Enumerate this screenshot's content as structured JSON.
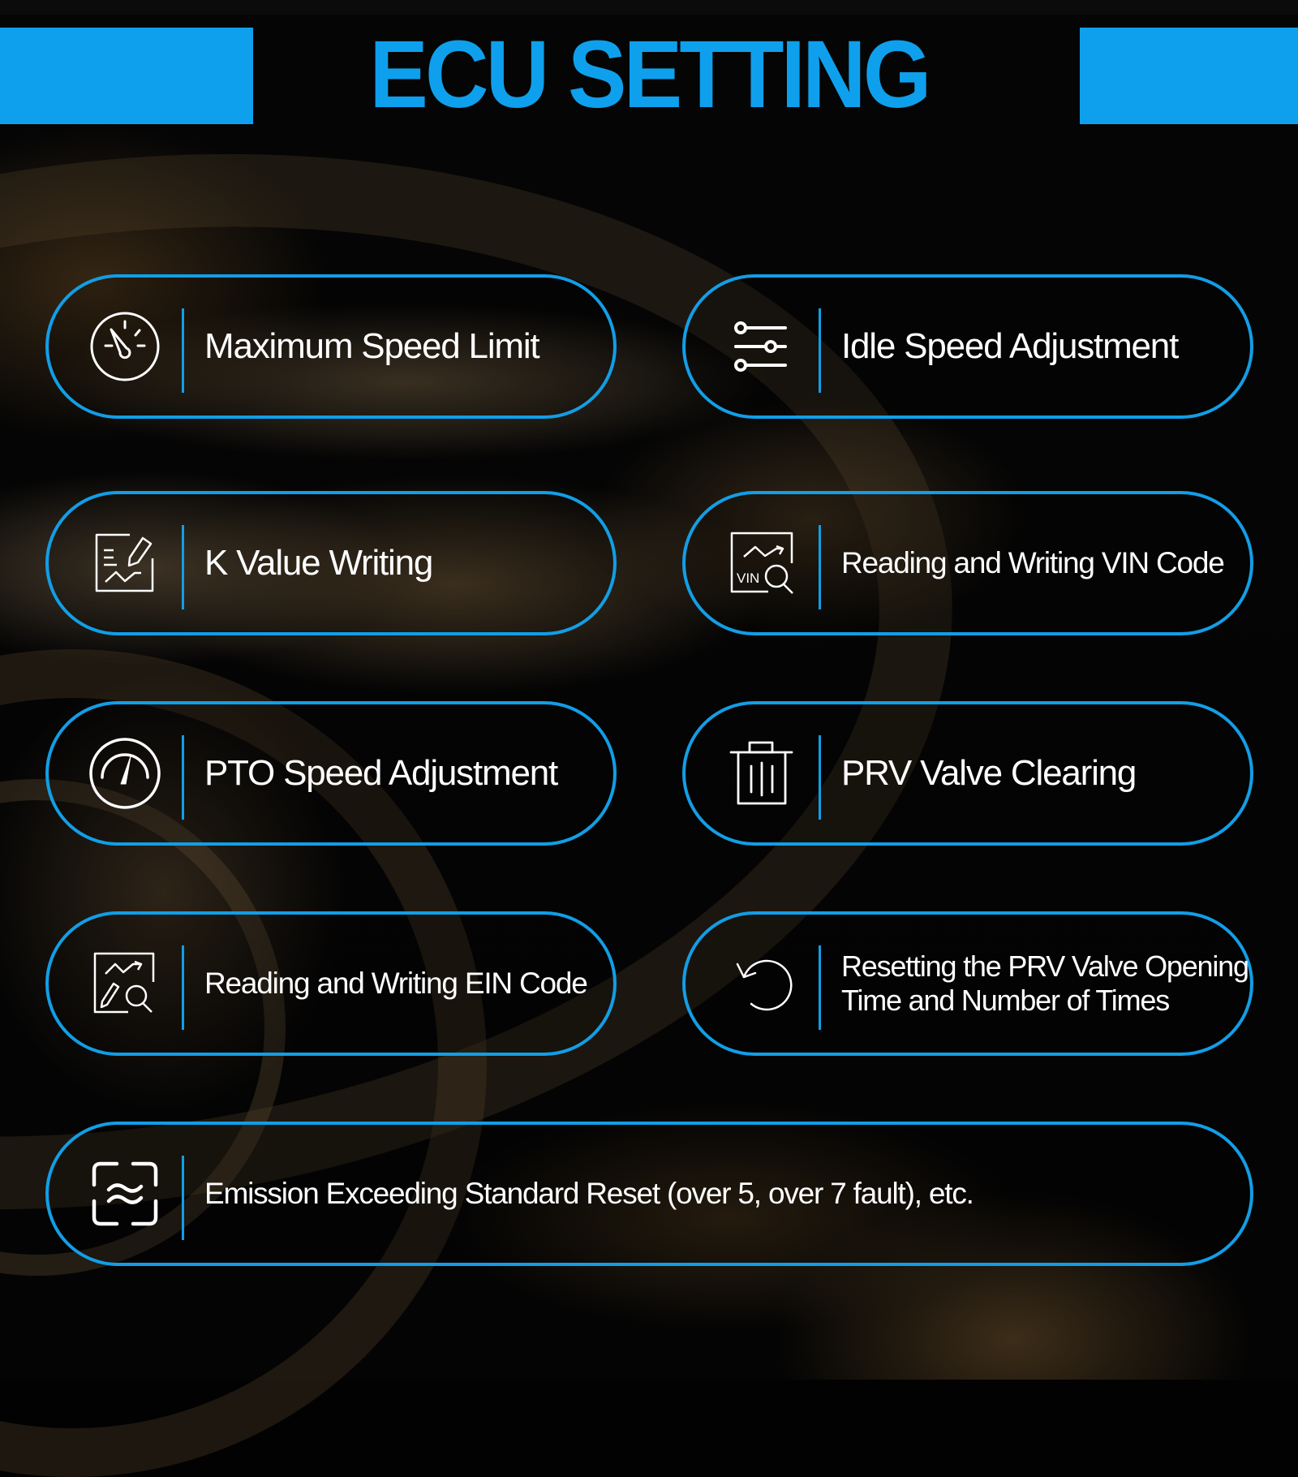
{
  "header": {
    "title": "ECU SETTING"
  },
  "theme": {
    "accent": "#0ea0ec",
    "pill_border": "#129ee6",
    "text": "#ffffff",
    "background": "#040404"
  },
  "features": [
    {
      "id": "maximum-speed-limit",
      "label": "Maximum Speed Limit",
      "icon": "speedometer-icon"
    },
    {
      "id": "idle-speed-adjustment",
      "label": "Idle Speed Adjustment",
      "icon": "sliders-icon"
    },
    {
      "id": "k-value-writing",
      "label": "K Value Writing",
      "icon": "edit-document-icon"
    },
    {
      "id": "vin-code",
      "label": "Reading and Writing VIN Code",
      "icon": "vin-search-icon",
      "icon_text": "VIN"
    },
    {
      "id": "pto-speed-adjustment",
      "label": "PTO Speed Adjustment",
      "icon": "gauge-icon"
    },
    {
      "id": "prv-valve-clearing",
      "label": "PRV Valve Clearing",
      "icon": "trash-icon"
    },
    {
      "id": "ein-code",
      "label": "Reading and Writing EIN Code",
      "icon": "document-search-icon"
    },
    {
      "id": "prv-reset",
      "label_line1": "Resetting the PRV Valve Opening",
      "label_line2": "Time and Number of Times",
      "icon": "reset-arrow-icon"
    },
    {
      "id": "emission-reset",
      "label": "Emission Exceeding Standard Reset (over 5, over 7 fault), etc.",
      "icon": "emission-scan-icon"
    }
  ]
}
